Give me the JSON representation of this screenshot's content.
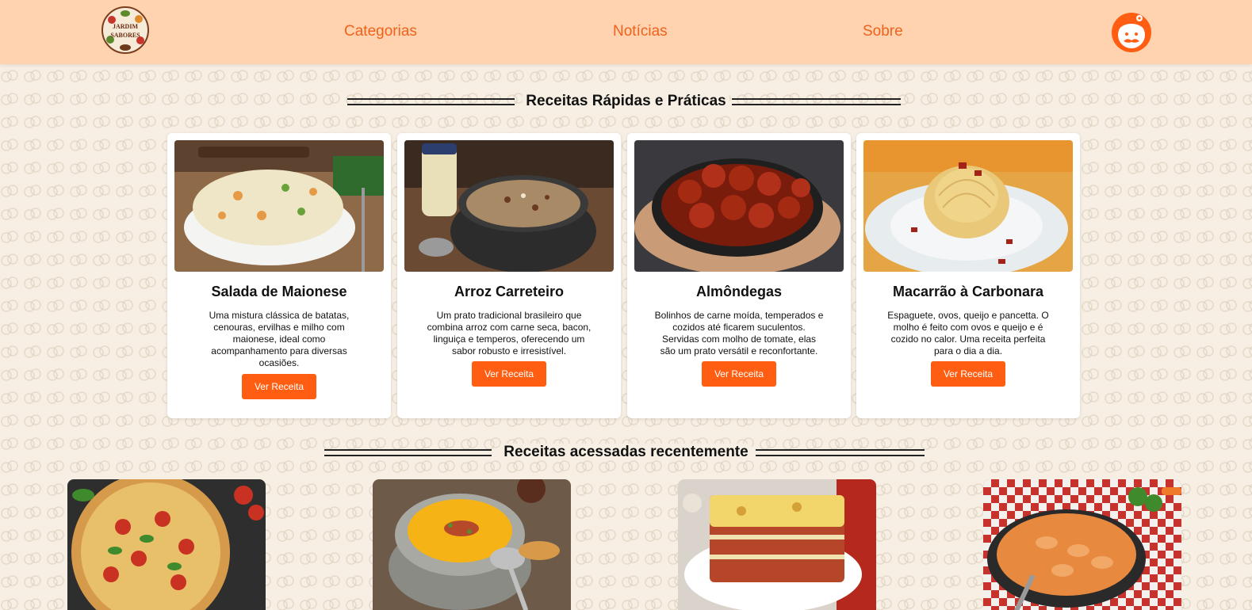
{
  "nav": {
    "logo_line1": "JARDIM",
    "logo_line2": "SABORES",
    "links": [
      "Categorias",
      "Notícias",
      "Sobre"
    ],
    "avatar_icon": "chef-avatar-icon"
  },
  "colors": {
    "accent": "#ff5e12",
    "nav_bg": "#ffd3af",
    "nav_text": "#f0621c",
    "page_bg": "#f7efe3"
  },
  "quick": {
    "title": "Receitas Rápidas e Práticas",
    "recipes": [
      {
        "name": "Salada de Maionese",
        "description": "Uma mistura clássica de batatas, cenouras, ervilhas e milho com maionese, ideal como acompanhamento para diversas ocasiões.",
        "button": "Ver Receita"
      },
      {
        "name": "Arroz Carreteiro",
        "description": "Um prato tradicional brasileiro que combina arroz com carne seca, bacon, linguiça e temperos, oferecendo um sabor robusto e irresistível.",
        "button": "Ver Receita"
      },
      {
        "name": "Almôndegas",
        "description": "Bolinhos de carne moída, temperados e cozidos até ficarem suculentos. Servidas com molho de tomate, elas são um prato versátil e reconfortante.",
        "button": "Ver Receita"
      },
      {
        "name": "Macarrão à Carbonara",
        "description": "Espaguete, ovos, queijo e pancetta. O molho é feito com ovos e queijo e é cozido no calor. Uma receita perfeita para o dia a dia.",
        "button": "Ver Receita"
      }
    ]
  },
  "recent": {
    "title": "Receitas acessadas recentemente"
  }
}
